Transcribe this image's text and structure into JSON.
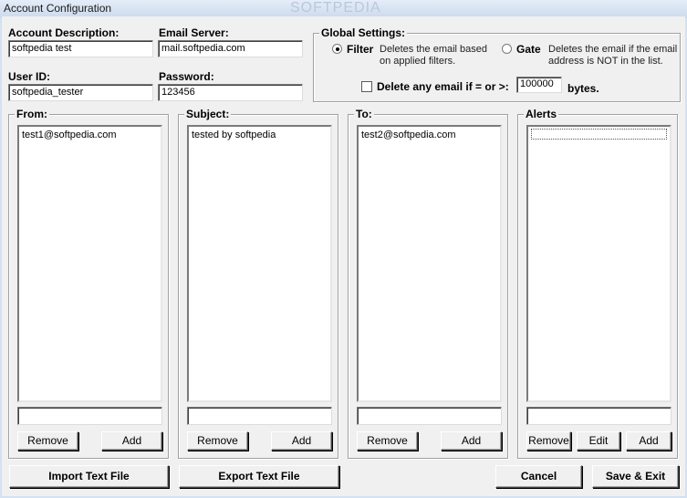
{
  "window": {
    "title": "Account Configuration",
    "watermark": "SOFTPEDIA"
  },
  "account": {
    "description_label": "Account Description:",
    "description_value": "softpedia test",
    "server_label": "Email Server:",
    "server_value": "mail.softpedia.com",
    "userid_label": "User ID:",
    "userid_value": "softpedia_tester",
    "password_label": "Password:",
    "password_value": "123456"
  },
  "global": {
    "title": "Global Settings:",
    "filter_label": "Filter",
    "filter_desc_line1": "Deletes the email based",
    "filter_desc_line2": "on applied filters.",
    "filter_selected": true,
    "gate_label": "Gate",
    "gate_desc_line1": "Deletes the email if the email",
    "gate_desc_line2": "address is NOT in the list.",
    "gate_selected": false,
    "delete_label": "Delete any email if = or >:",
    "delete_checked": false,
    "size_value": "100000",
    "bytes_label": "bytes."
  },
  "lists": {
    "from": {
      "title": "From:",
      "items": [
        "test1@softpedia.com"
      ],
      "remove": "Remove",
      "add": "Add"
    },
    "subject": {
      "title": "Subject:",
      "items": [
        "tested by softpedia"
      ],
      "remove": "Remove",
      "add": "Add"
    },
    "to": {
      "title": "To:",
      "items": [
        "test2@softpedia.com"
      ],
      "remove": "Remove",
      "add": "Add"
    },
    "alerts": {
      "title": "Alerts",
      "items": [],
      "remove": "Remove",
      "edit": "Edit",
      "add": "Add"
    }
  },
  "footer": {
    "import": "Import Text File",
    "export": "Export Text File",
    "cancel": "Cancel",
    "save_exit": "Save & Exit"
  }
}
